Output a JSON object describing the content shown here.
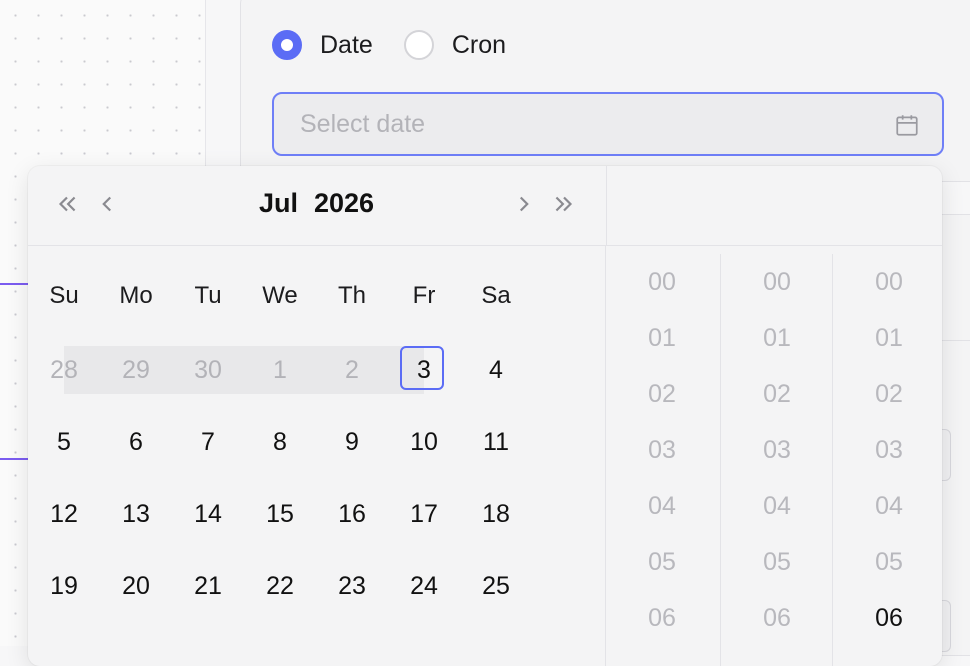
{
  "schedule": {
    "options": [
      {
        "label": "Date",
        "checked": true
      },
      {
        "label": "Cron",
        "checked": false
      }
    ],
    "date_input": {
      "placeholder": "Select date",
      "value": ""
    }
  },
  "calendar": {
    "month": "Jul",
    "year": "2026",
    "weekdays": [
      "Su",
      "Mo",
      "Tu",
      "We",
      "Th",
      "Fr",
      "Sa"
    ],
    "weeks": [
      [
        "28",
        "29",
        "30",
        "1",
        "2",
        "3",
        "4"
      ],
      [
        "5",
        "6",
        "7",
        "8",
        "9",
        "10",
        "11"
      ],
      [
        "12",
        "13",
        "14",
        "15",
        "16",
        "17",
        "18"
      ],
      [
        "19",
        "20",
        "21",
        "22",
        "23",
        "24",
        "25"
      ]
    ],
    "out_of_month": [
      [
        0,
        0
      ],
      [
        0,
        1
      ],
      [
        0,
        2
      ],
      [
        0,
        3
      ],
      [
        0,
        4
      ]
    ],
    "today": [
      0,
      5
    ]
  },
  "time": {
    "hours": [
      "00",
      "01",
      "02",
      "03",
      "04",
      "05",
      "06"
    ],
    "minutes": [
      "00",
      "01",
      "02",
      "03",
      "04",
      "05",
      "06"
    ],
    "seconds": [
      "00",
      "01",
      "02",
      "03",
      "04",
      "05",
      "06"
    ],
    "selected_second": "06"
  },
  "colors": {
    "accent": "#5b6cf5",
    "edge": "#7b5cf0"
  },
  "icons": [
    "calendar-icon",
    "double-chevron-left-icon",
    "chevron-left-icon",
    "chevron-right-icon",
    "double-chevron-right-icon"
  ]
}
